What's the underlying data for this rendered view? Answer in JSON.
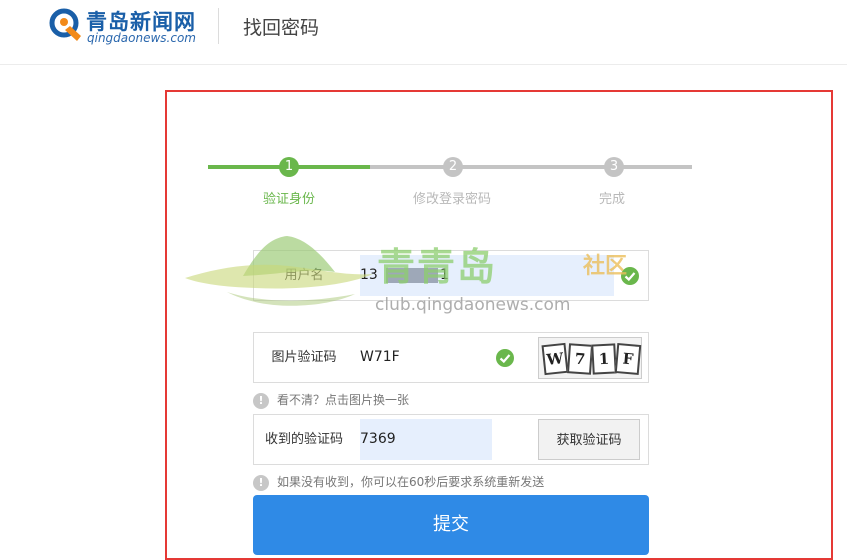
{
  "header": {
    "logo_cn": "青岛新闻网",
    "logo_en": "qingdaonews.com",
    "title": "找回密码"
  },
  "steps": [
    {
      "number": "1",
      "label": "验证身份",
      "state": "active"
    },
    {
      "number": "2",
      "label": "修改登录密码",
      "state": "inactive"
    },
    {
      "number": "3",
      "label": "完成",
      "state": "inactive"
    }
  ],
  "form": {
    "username": {
      "label": "用户名",
      "value_prefix": "13",
      "value_suffix": "1"
    },
    "image_captcha": {
      "label": "图片验证码",
      "value": "W71F",
      "captcha_chars": [
        "W",
        "7",
        "1",
        "F"
      ]
    },
    "image_hint": "看不清？点击图片换一张",
    "sms_code": {
      "label": "收到的验证码",
      "value": "7369",
      "button_label": "获取验证码"
    },
    "sms_hint": "如果没有收到，你可以在60秒后要求系统重新发送",
    "submit_label": "提交"
  },
  "watermark": {
    "title": "青青岛",
    "tag": "社区",
    "url": "club.qingdaonews.com"
  },
  "colors": {
    "accent_green": "#6ab74c",
    "inactive_gray": "#c4c4c4",
    "primary_blue": "#2f8ae6",
    "highlight_border": "#e53935",
    "input_fill": "#e6effd"
  }
}
